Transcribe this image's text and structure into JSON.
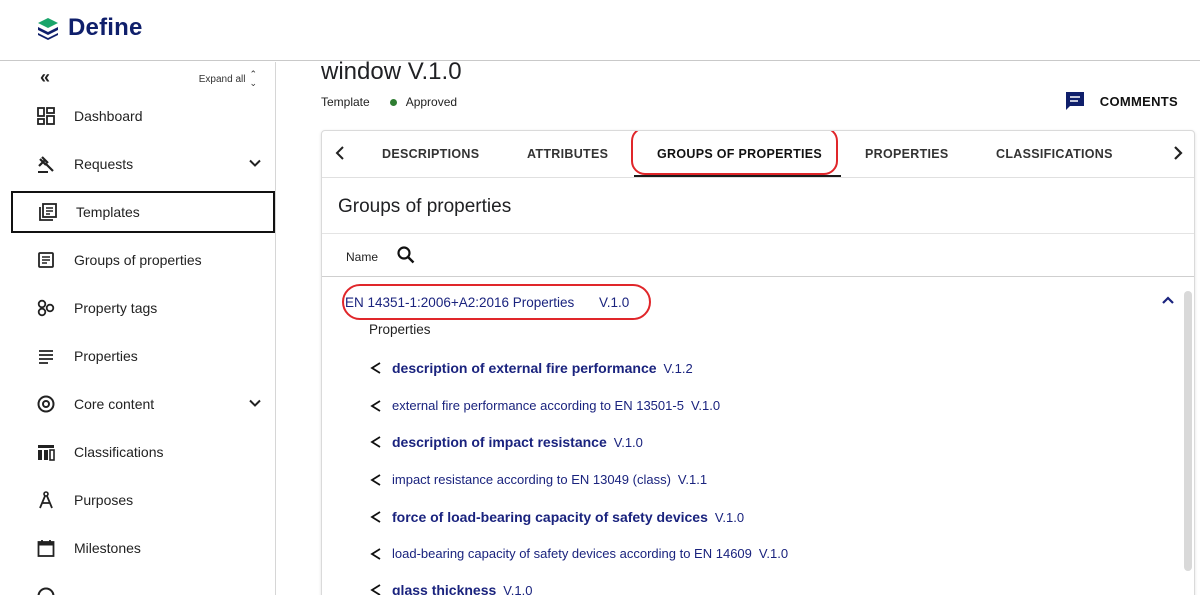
{
  "app": {
    "logo_text": "Define",
    "brand_color": "#0f1f6b"
  },
  "sidebar": {
    "collapse_icon": "double-chevron-left-icon",
    "expand_all_label": "Expand all",
    "items": [
      {
        "label": "Dashboard",
        "icon": "dashboard-icon",
        "expandable": false,
        "active": false
      },
      {
        "label": "Requests",
        "icon": "gavel-icon",
        "expandable": true,
        "active": false
      },
      {
        "label": "Templates",
        "icon": "library-books-icon",
        "expandable": false,
        "active": true
      },
      {
        "label": "Groups of properties",
        "icon": "article-icon",
        "expandable": false,
        "active": false
      },
      {
        "label": "Property tags",
        "icon": "tags-icon",
        "expandable": false,
        "active": false
      },
      {
        "label": "Properties",
        "icon": "list-icon",
        "expandable": false,
        "active": false
      },
      {
        "label": "Core content",
        "icon": "at-sign-icon",
        "expandable": true,
        "active": false
      },
      {
        "label": "Classifications",
        "icon": "classification-icon",
        "expandable": false,
        "active": false
      },
      {
        "label": "Purposes",
        "icon": "compass-icon",
        "expandable": false,
        "active": false
      },
      {
        "label": "Milestones",
        "icon": "calendar-icon",
        "expandable": false,
        "active": false
      }
    ]
  },
  "header": {
    "title": "window V.1.0",
    "type_label": "Template",
    "status_label": "Approved",
    "status_color": "#2e7d32",
    "comments_label": "COMMENTS"
  },
  "tabs": {
    "items": [
      "DESCRIPTIONS",
      "ATTRIBUTES",
      "GROUPS OF PROPERTIES",
      "PROPERTIES",
      "CLASSIFICATIONS"
    ],
    "active": "GROUPS OF PROPERTIES"
  },
  "content": {
    "section_title": "Groups of properties",
    "filter_label": "Name",
    "group": {
      "title": "EN 14351-1:2006+A2:2016 Properties",
      "version": "V.1.0",
      "expanded": true,
      "properties_label": "Properties",
      "properties": [
        {
          "name": "description of external fire performance",
          "version": "V.1.2",
          "bold": true
        },
        {
          "name": "external fire performance according to EN 13501-5",
          "version": "V.1.0",
          "bold": false
        },
        {
          "name": "description of impact resistance",
          "version": "V.1.0",
          "bold": true
        },
        {
          "name": "impact resistance according to EN 13049 (class)",
          "version": "V.1.1",
          "bold": false
        },
        {
          "name": "force of load-bearing capacity of safety devices",
          "version": "V.1.0",
          "bold": true
        },
        {
          "name": "load-bearing capacity of safety devices according to EN 14609",
          "version": "V.1.0",
          "bold": false
        },
        {
          "name": "glass thickness",
          "version": "V.1.0",
          "bold": true
        }
      ]
    }
  },
  "annotation_color": "#e0262a"
}
